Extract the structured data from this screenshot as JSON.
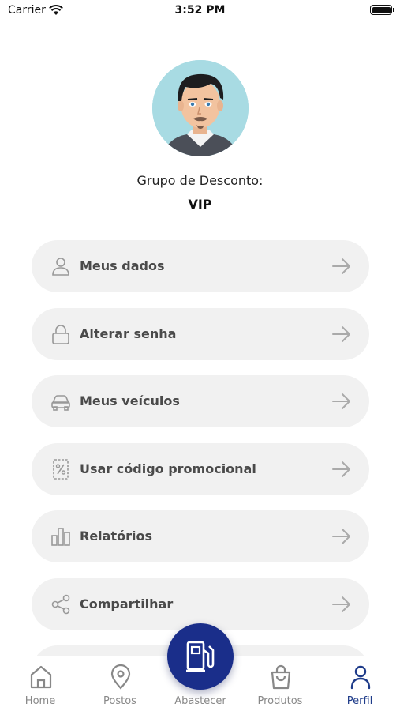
{
  "status_bar": {
    "carrier": "Carrier",
    "time": "3:52 PM"
  },
  "profile": {
    "group_label": "Grupo de Desconto:",
    "group_value": "VIP"
  },
  "menu": [
    {
      "label": "Meus dados",
      "icon": "user-icon"
    },
    {
      "label": "Alterar senha",
      "icon": "lock-icon"
    },
    {
      "label": "Meus veículos",
      "icon": "car-icon"
    },
    {
      "label": "Usar código promocional",
      "icon": "percent-tag-icon"
    },
    {
      "label": "Relatórios",
      "icon": "bar-chart-icon"
    },
    {
      "label": "Compartilhar",
      "icon": "share-icon"
    }
  ],
  "tabs": [
    {
      "label": "Home",
      "icon": "home-icon"
    },
    {
      "label": "Postos",
      "icon": "map-pin-icon"
    },
    {
      "label": "Abastecer",
      "icon": "fuel-pump-icon"
    },
    {
      "label": "Produtos",
      "icon": "shopping-bag-icon"
    },
    {
      "label": "Perfil",
      "icon": "user-icon",
      "active": true
    }
  ],
  "colors": {
    "accent": "#1a2e8a",
    "active_tab": "#1f3c8a",
    "menu_background": "#f1f1f1",
    "inactive": "#888888"
  }
}
